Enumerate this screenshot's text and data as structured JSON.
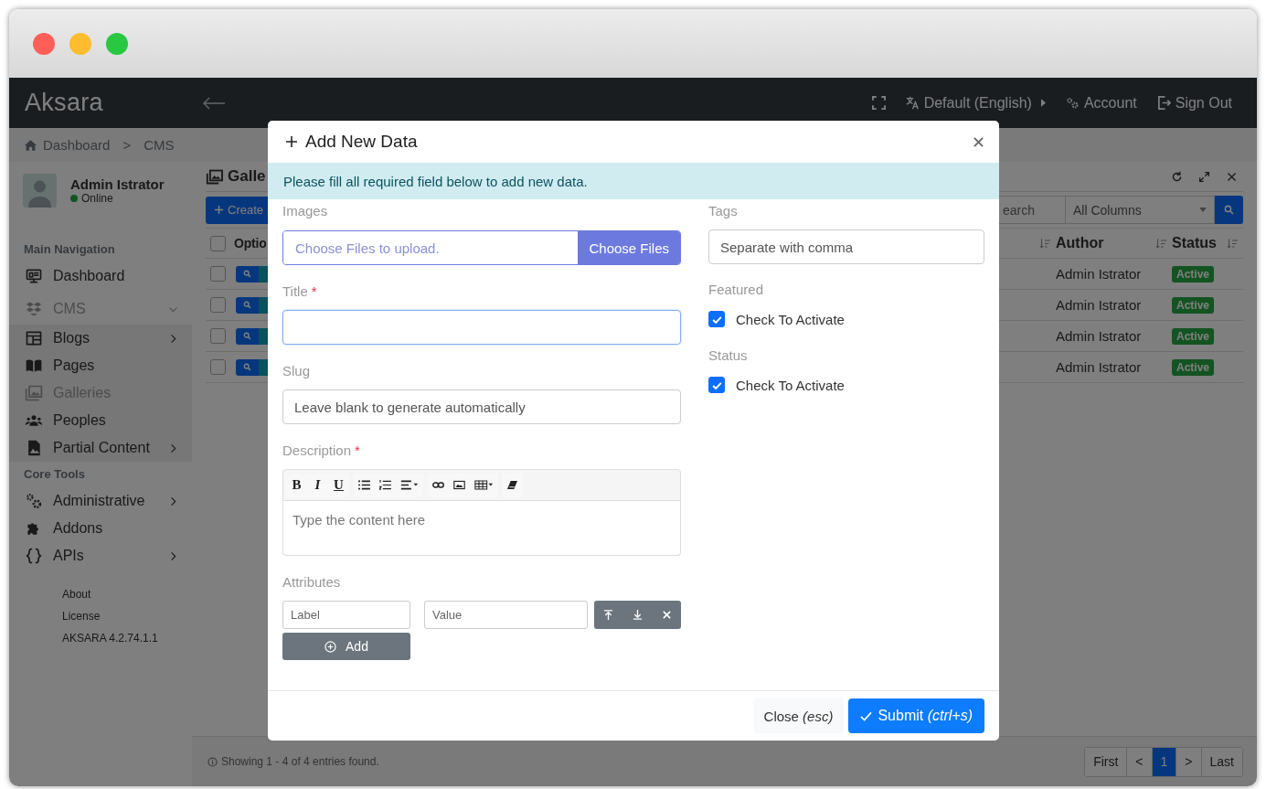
{
  "navbar": {
    "brand": "Aksara",
    "language": "Default (English)",
    "account": "Account",
    "sign_out": "Sign Out"
  },
  "breadcrumb": {
    "items": [
      "Dashboard",
      "CMS"
    ],
    "separator": ">"
  },
  "sidebar": {
    "user": {
      "name": "Admin Istrator",
      "status": "Online",
      "online": true
    },
    "sections": [
      {
        "title": "Main Navigation",
        "items": [
          {
            "label": "Dashboard",
            "kind": "link",
            "selected": false
          },
          {
            "label": "CMS",
            "kind": "submenu",
            "expanded": true,
            "selected": true,
            "children": [
              {
                "label": "Blogs",
                "kind": "submenu",
                "expanded": false,
                "selected": false
              },
              {
                "label": "Pages",
                "kind": "link",
                "selected": false
              },
              {
                "label": "Galleries",
                "kind": "link",
                "selected": true
              },
              {
                "label": "Peoples",
                "kind": "link",
                "selected": false
              },
              {
                "label": "Partial Content",
                "kind": "submenu",
                "expanded": false,
                "selected": false
              }
            ]
          }
        ]
      },
      {
        "title": "Core Tools",
        "items": [
          {
            "label": "Administrative",
            "kind": "submenu",
            "expanded": false,
            "selected": false
          },
          {
            "label": "Addons",
            "kind": "link",
            "selected": false
          },
          {
            "label": "APIs",
            "kind": "submenu",
            "expanded": false,
            "selected": false
          }
        ]
      }
    ],
    "links": [
      "About",
      "License",
      "AKSARA 4.2.74.1.1"
    ]
  },
  "main": {
    "title": "Galle",
    "create_button": "Create",
    "search": {
      "placeholder": "earch"
    },
    "column_select": "All Columns",
    "table": {
      "select_all": {
        "checked": false
      },
      "columns": [
        "Optio",
        "Author",
        "Status"
      ],
      "rows": [
        {
          "checked": false,
          "author": "Admin Istrator",
          "status": "Active"
        },
        {
          "checked": false,
          "author": "Admin Istrator",
          "status": "Active"
        },
        {
          "checked": false,
          "author": "Admin Istrator",
          "status": "Active"
        },
        {
          "checked": false,
          "author": "Admin Istrator",
          "status": "Active"
        }
      ]
    },
    "footer": {
      "info": "Showing 1 - 4 of 4 entries found.",
      "pagination": [
        {
          "label": "First",
          "selected": false
        },
        {
          "label": "<",
          "selected": false
        },
        {
          "label": "1",
          "selected": true
        },
        {
          "label": ">",
          "selected": false
        },
        {
          "label": "Last",
          "selected": false
        }
      ]
    }
  },
  "modal": {
    "title": "Add New Data",
    "alert": "Please fill all required field below to add new data.",
    "images": {
      "label": "Images",
      "placeholder": "Choose Files to upload.",
      "button": "Choose Files"
    },
    "title_field": {
      "label": "Title",
      "required_mark": "*",
      "focused": true
    },
    "slug": {
      "label": "Slug",
      "placeholder": "Leave blank to generate automatically"
    },
    "description": {
      "label": "Description",
      "required_mark": "*",
      "format_buttons": [
        "B",
        "I",
        "U"
      ],
      "placeholder": "Type the content here"
    },
    "attributes": {
      "label": "Attributes",
      "label_placeholder": "Label",
      "value_placeholder": "Value",
      "add_button": "Add"
    },
    "tags": {
      "label": "Tags",
      "placeholder": "Separate with comma"
    },
    "featured": {
      "label": "Featured",
      "checkbox_label": "Check To Activate",
      "checked": true
    },
    "status": {
      "label": "Status",
      "checkbox_label": "Check To Activate",
      "checked": true
    },
    "close_button": "Close *(esc)*",
    "submit_button": "Submit *(ctrl+s)*"
  }
}
